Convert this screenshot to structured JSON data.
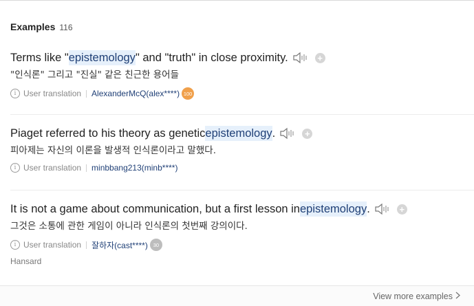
{
  "header": {
    "title": "Examples",
    "count": "116"
  },
  "examples": [
    {
      "en_pre": "Terms like \"",
      "en_hl": "epistemology",
      "en_post": "\" and \"truth\" in close proximity.",
      "ko": "\"인식론\" 그리고 \"진실\" 같은 친근한 용어들",
      "type": "User translation",
      "user": "AlexanderMcQ(alex****)",
      "badge": "100",
      "badge_color": "#f0a04b"
    },
    {
      "en_pre": "Piaget referred to his theory as genetic ",
      "en_hl": "epistemology",
      "en_post": ".",
      "ko": "피아제는 자신의 이론을 발생적 인식론이라고 말했다.",
      "type": "User translation",
      "user": "minbbang213(minb****)"
    },
    {
      "en_pre": "It is not a game about communication, but a first lesson in ",
      "en_hl": "epistemology",
      "en_post": ".",
      "ko": "그것은 소통에 관한 게임이 아니라 인식론의 첫번째 강의이다.",
      "type": "User translation",
      "user": "잘하자(cast****)",
      "badge": "30",
      "badge_color": "#bdbdbd",
      "source": "Hansard"
    }
  ],
  "icons": {
    "speaker": "speaker-icon",
    "plus": "plus-icon",
    "info": "info-icon",
    "chevron": "chevron-right-icon"
  },
  "footer": {
    "more_label": "View more examples"
  },
  "colors": {
    "highlight_bg": "#e6f0fb",
    "link": "#1f3f76"
  }
}
